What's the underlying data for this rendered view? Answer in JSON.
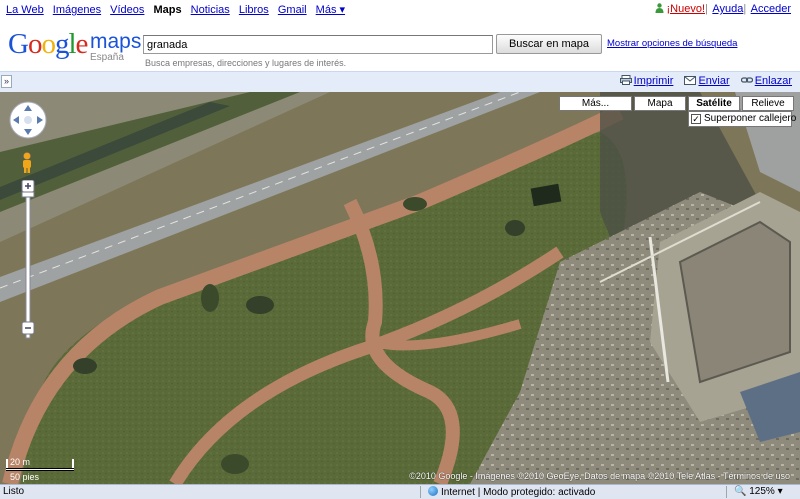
{
  "topnav": {
    "links": [
      "La Web",
      "Imágenes",
      "Vídeos",
      "Maps",
      "Noticias",
      "Libros",
      "Gmail",
      "Más ▾"
    ],
    "active": "Maps",
    "nuevo": "¡Nuevo!",
    "ayuda": "Ayuda",
    "acceder": "Acceder"
  },
  "header": {
    "logo_text": "Google",
    "maps_word": "maps",
    "country": "España",
    "search_value": "granada",
    "search_button": "Buscar en mapa",
    "search_hint": "Busca empresas, direcciones y lugares de interés.",
    "options_link": "Mostrar opciones de búsqueda"
  },
  "toolbar": {
    "collapse": "»",
    "print": "Imprimir",
    "send": "Enviar",
    "link": "Enlazar"
  },
  "map": {
    "types": [
      "Más...",
      "Mapa",
      "Satélite",
      "Relieve"
    ],
    "selected_type": "Satélite",
    "overlay_label": "Superponer callejero",
    "overlay_checked": true,
    "scale_metric": "20 m",
    "scale_imperial": "50 pies",
    "copyright": "©2010 Google - Imágenes ©2010 GeoEye, Datos de mapa ©2010 Tele Atlas - Términos de uso"
  },
  "statusbar": {
    "status": "Listo",
    "zone": "Internet | Modo protegido: activado",
    "zoom": "125%"
  },
  "colors": {
    "link": "#0000cc",
    "toolbar_bg": "#e5ecf9",
    "grass": "#5d6b3a",
    "path": "#b9826a"
  }
}
